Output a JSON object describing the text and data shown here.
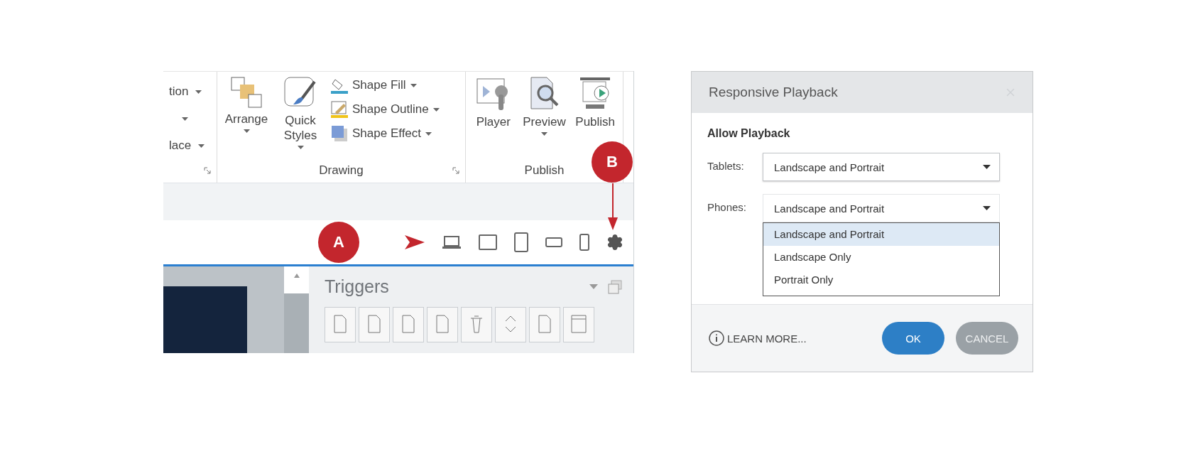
{
  "ribbon": {
    "cut_group": {
      "rows": [
        {
          "kind": "text",
          "label": "tion"
        },
        {
          "kind": "caret"
        },
        {
          "kind": "text",
          "label": "lace"
        }
      ]
    },
    "drawing_group": {
      "title": "Drawing",
      "large_buttons": [
        {
          "label": "Arrange",
          "dropdown": true
        },
        {
          "label": "Quick Styles",
          "dropdown": true
        }
      ],
      "small_buttons": [
        {
          "label": "Shape Fill"
        },
        {
          "label": "Shape Outline"
        },
        {
          "label": "Shape Effect"
        }
      ]
    },
    "publish_group": {
      "title": "Publish",
      "buttons": [
        {
          "label": "Player",
          "dropdown": false
        },
        {
          "label": "Preview",
          "dropdown": true
        },
        {
          "label": "Publish",
          "dropdown": false
        }
      ]
    }
  },
  "callouts": [
    {
      "label": "A"
    },
    {
      "label": "B"
    }
  ],
  "triggers_panel": {
    "title": "Triggers"
  },
  "dialog": {
    "title": "Responsive Playback",
    "section": "Allow Playback",
    "fields": [
      {
        "label": "Tablets:",
        "value": "Landscape and Portrait",
        "expanded": false
      },
      {
        "label": "Phones:",
        "value": "Landscape and Portrait",
        "expanded": true,
        "options": [
          {
            "label": "Landscape and Portrait",
            "selected": true
          },
          {
            "label": "Landscape Only",
            "selected": false
          },
          {
            "label": "Portrait Only",
            "selected": false
          }
        ]
      }
    ],
    "learn_more": "LEARN MORE...",
    "buttons": [
      {
        "label": "OK",
        "kind": "primary"
      },
      {
        "label": "CANCEL",
        "kind": "secondary"
      }
    ]
  }
}
